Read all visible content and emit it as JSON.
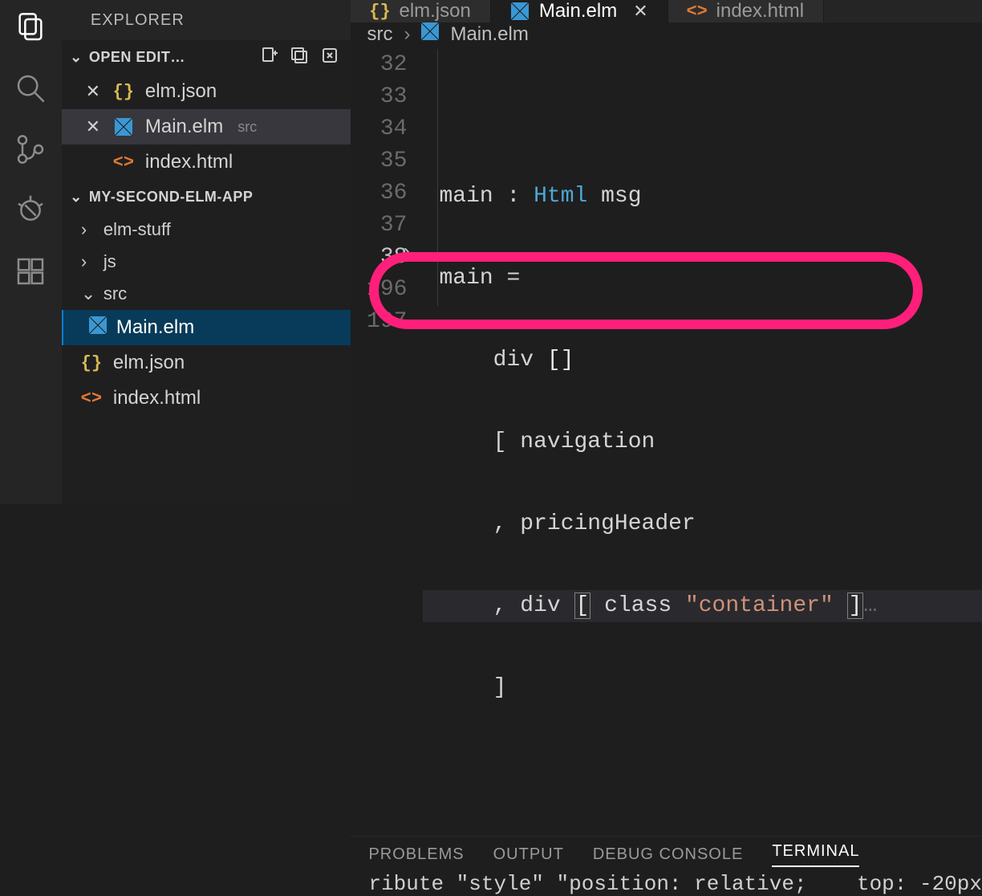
{
  "sidebar": {
    "title": "EXPLORER",
    "open_editors_label": "OPEN EDIT…",
    "open_editors": [
      {
        "name": "elm.json",
        "meta": "",
        "icon": "braces",
        "close": true,
        "active": false
      },
      {
        "name": "Main.elm",
        "meta": "src",
        "icon": "elm",
        "close": true,
        "active": true
      },
      {
        "name": "index.html",
        "meta": "",
        "icon": "html",
        "close": false,
        "active": false
      }
    ],
    "workspace_label": "MY-SECOND-ELM-APP",
    "tree": {
      "folders": [
        {
          "name": "elm-stuff",
          "expanded": false
        },
        {
          "name": "js",
          "expanded": false
        },
        {
          "name": "src",
          "expanded": true,
          "children": [
            {
              "name": "Main.elm",
              "icon": "elm",
              "selected": true
            }
          ]
        }
      ],
      "root_files": [
        {
          "name": "elm.json",
          "icon": "braces"
        },
        {
          "name": "index.html",
          "icon": "html"
        }
      ]
    }
  },
  "tabs": [
    {
      "label": "elm.json",
      "icon": "braces",
      "active": false,
      "close": false
    },
    {
      "label": "Main.elm",
      "icon": "elm",
      "active": true,
      "close": true
    },
    {
      "label": "index.html",
      "icon": "html",
      "active": false,
      "close": false
    }
  ],
  "breadcrumb": {
    "a": "src",
    "b": "Main.elm"
  },
  "editor": {
    "line_numbers": [
      "32",
      "33",
      "34",
      "35",
      "36",
      "37",
      "38",
      "196",
      "197"
    ],
    "current_line_index": 6,
    "lines": {
      "l33_fn": "main",
      "l33_colon": " : ",
      "l33_type": "Html",
      "l33_msg": " msg",
      "l34": "main =",
      "l35_pre": "    div ",
      "l35_br": "[]",
      "l36": "    [ navigation",
      "l37": "    , pricingHeader",
      "l38_pre": "    , div ",
      "l38_lbr": "[",
      "l38_mid": " class ",
      "l38_str": "\"container\"",
      "l38_sp": " ",
      "l38_rbr": "]",
      "l38_ell": "…",
      "l196": "    ]"
    }
  },
  "panel": {
    "tabs": {
      "problems": "PROBLEMS",
      "output": "OUTPUT",
      "debug": "DEBUG CONSOLE",
      "terminal": "TERMINAL"
    },
    "terminal_line": "ribute \"style\" \"position: relative;    top: -20px"
  }
}
